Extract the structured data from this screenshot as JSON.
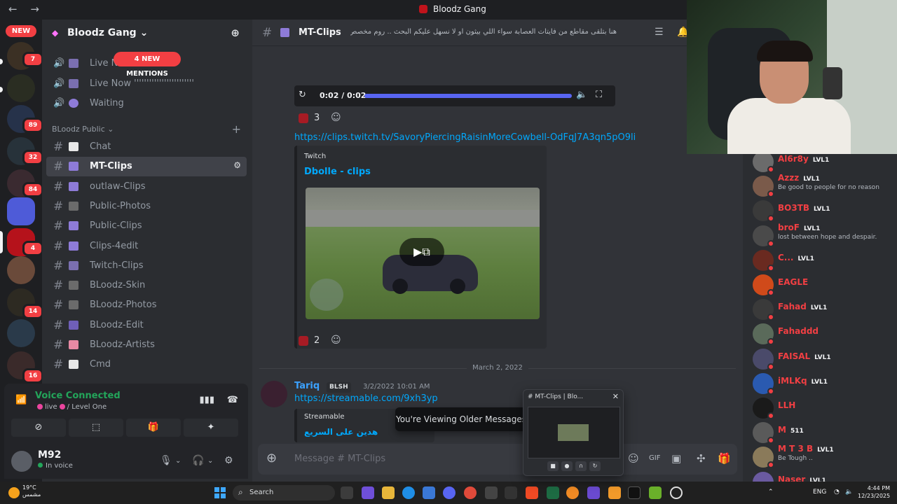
{
  "window": {
    "title": "Bloodz Gang",
    "back": "←",
    "forward": "→"
  },
  "rail": {
    "new_label": "NEW",
    "badges": [
      "7",
      "89",
      "32",
      "84",
      "4",
      "14",
      "16"
    ]
  },
  "server": {
    "name": "Bloodz Gang",
    "chevron": "⌄",
    "invite_icon": "person-add-icon"
  },
  "mentions_label": "4 NEW MENTIONS",
  "voice_channels": [
    {
      "name": "Live Now"
    },
    {
      "name": "Live Now ''''''''''''''''''''''''"
    },
    {
      "name": "Waiting"
    }
  ],
  "category": {
    "name": "BLoodz Public",
    "chevron": "⌄",
    "plus": "+"
  },
  "channels": [
    {
      "name": "Chat",
      "emoji_color": "#e8e8e8"
    },
    {
      "name": "MT-Clips",
      "emoji_color": "#8e7bd8",
      "active": true
    },
    {
      "name": "outlaw-Clips",
      "emoji_color": "#8e7bd8"
    },
    {
      "name": "Public-Photos",
      "emoji_color": "#6b6b6b"
    },
    {
      "name": "Public-Clips",
      "emoji_color": "#8e7bd8"
    },
    {
      "name": "Clips-4edit",
      "emoji_color": "#8e7bd8"
    },
    {
      "name": "Twitch-Clips",
      "emoji_color": "#7a6fb0"
    },
    {
      "name": "BLoodz-Skin",
      "emoji_color": "#6b6b6b"
    },
    {
      "name": "BLoodz-Photos",
      "emoji_color": "#6b6b6b"
    },
    {
      "name": "BLoodz-Edit",
      "emoji_color": "#6f5fb8"
    },
    {
      "name": "BLoodz-Artists",
      "emoji_color": "#e88aa4"
    },
    {
      "name": "Cmd",
      "emoji_color": "#e8e8e8"
    }
  ],
  "channel_actions": "⚙",
  "voice_panel": {
    "status": "Voice Connected",
    "sub_live": "live",
    "sub_level": "/ Level One",
    "buttons": [
      "⊘",
      "⬚",
      "🎁",
      "✦"
    ]
  },
  "user": {
    "name": "M92",
    "status": "In voice"
  },
  "chat_header": {
    "channel": "MT-Clips",
    "topic": "هنا بتلقى مقاطع من فايتات العصابة سواء اللي بيثون او لا نسهل عليكم البحث .. روم مخصص للمصممين"
  },
  "audio_player": {
    "time": "0:02 / 0:02",
    "progress": 1.0
  },
  "reactions": [
    {
      "count": "3"
    },
    {
      "count": "2"
    }
  ],
  "clip_link": "https://clips.twitch.tv/SavoryPiercingRaisinMoreCowbell-OdFqJ7A3qn5pO9li",
  "embed": {
    "provider": "Twitch",
    "title": "Dbolle - clips"
  },
  "date_divider": "March 2, 2022",
  "message": {
    "author": "Tariq",
    "tag": "BLSH",
    "timestamp": "3/2/2022 10:01 AM",
    "link": "https://streamable.com/9xh3yp",
    "embed_provider": "Streamable",
    "embed_title": "هدين على السريع"
  },
  "older_notice": "You're Viewing Older Messages",
  "composer": {
    "placeholder": "Message #",
    "channel": "MT-Clips"
  },
  "preview": {
    "title": "# MT-Clips | Blo..."
  },
  "members": [
    {
      "name": "Al6r8y",
      "level": "LVL1",
      "sub": ""
    },
    {
      "name": "Azzz",
      "level": "LVL1",
      "sub": "Be good to people for no reason"
    },
    {
      "name": "BO3TB",
      "level": "LVL1",
      "sub": ""
    },
    {
      "name": "broF",
      "level": "LVL1",
      "sub": "lost between hope and despair."
    },
    {
      "name": "C...",
      "level": "LVL1",
      "sub": ""
    },
    {
      "name": "EAGLE",
      "level": "",
      "sub": ""
    },
    {
      "name": "Fahad",
      "level": "LVL1",
      "sub": ""
    },
    {
      "name": "Fahaddd",
      "level": "",
      "sub": ""
    },
    {
      "name": "FAISAL",
      "level": "LVL1",
      "sub": ""
    },
    {
      "name": "iMLKq",
      "level": "LVL1",
      "sub": ""
    },
    {
      "name": "LLH",
      "level": "",
      "sub": ""
    },
    {
      "name": "M",
      "level": "511",
      "sub": ""
    },
    {
      "name": "M T 3 B",
      "level": "LVL1",
      "sub": "Be Tough .."
    },
    {
      "name": "Naser",
      "level": "LVL1",
      "sub": ""
    }
  ],
  "taskbar": {
    "weather_temp": "19°C",
    "weather_desc": "مشمس",
    "search": "Search",
    "lang": "ENG",
    "time": "4:44 PM",
    "date": "12/23/2025"
  }
}
